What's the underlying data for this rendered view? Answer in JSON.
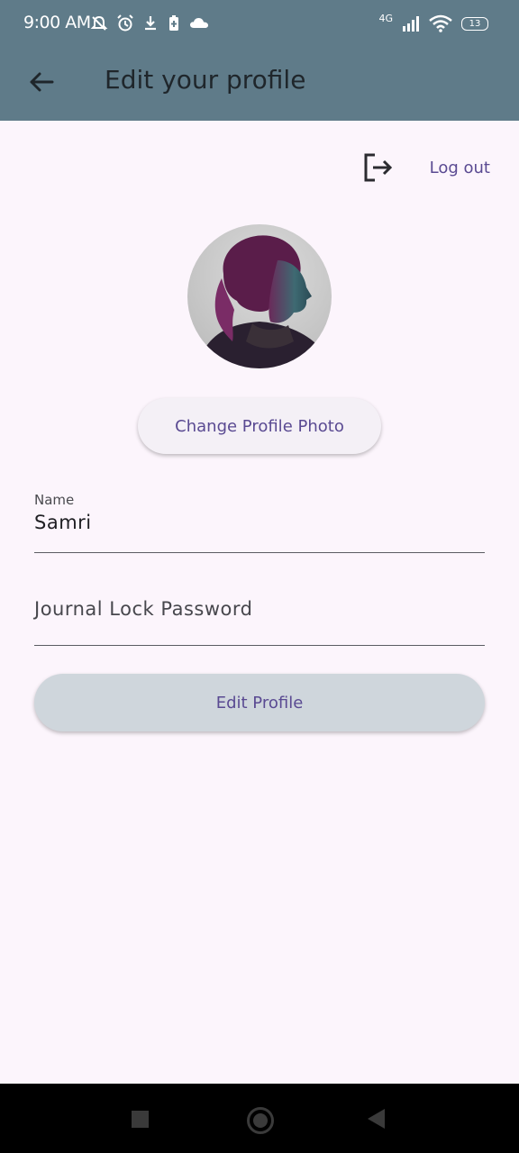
{
  "status_bar": {
    "time": "9:00 AM",
    "network": "4G",
    "battery": "13",
    "icons_left": [
      "mute-notifications-icon",
      "alarm-icon",
      "download-icon",
      "battery-saver-icon",
      "cloud-icon"
    ],
    "icons_right": [
      "signal-icon",
      "wifi-icon",
      "battery-icon"
    ]
  },
  "appbar": {
    "title": "Edit your profile",
    "back_icon": "arrow-left-icon"
  },
  "logout": {
    "label": "Log out",
    "icon": "logout-icon"
  },
  "profile": {
    "change_photo_label": "Change Profile Photo"
  },
  "form": {
    "name_label": "Name",
    "name_value": "Samri",
    "password_placeholder": "Journal Lock Password",
    "submit_label": "Edit Profile"
  },
  "colors": {
    "appbar": "#5f7b89",
    "background": "#fcf5fc",
    "accent": "#5a4a92",
    "button_secondary": "#cfd6dc"
  }
}
